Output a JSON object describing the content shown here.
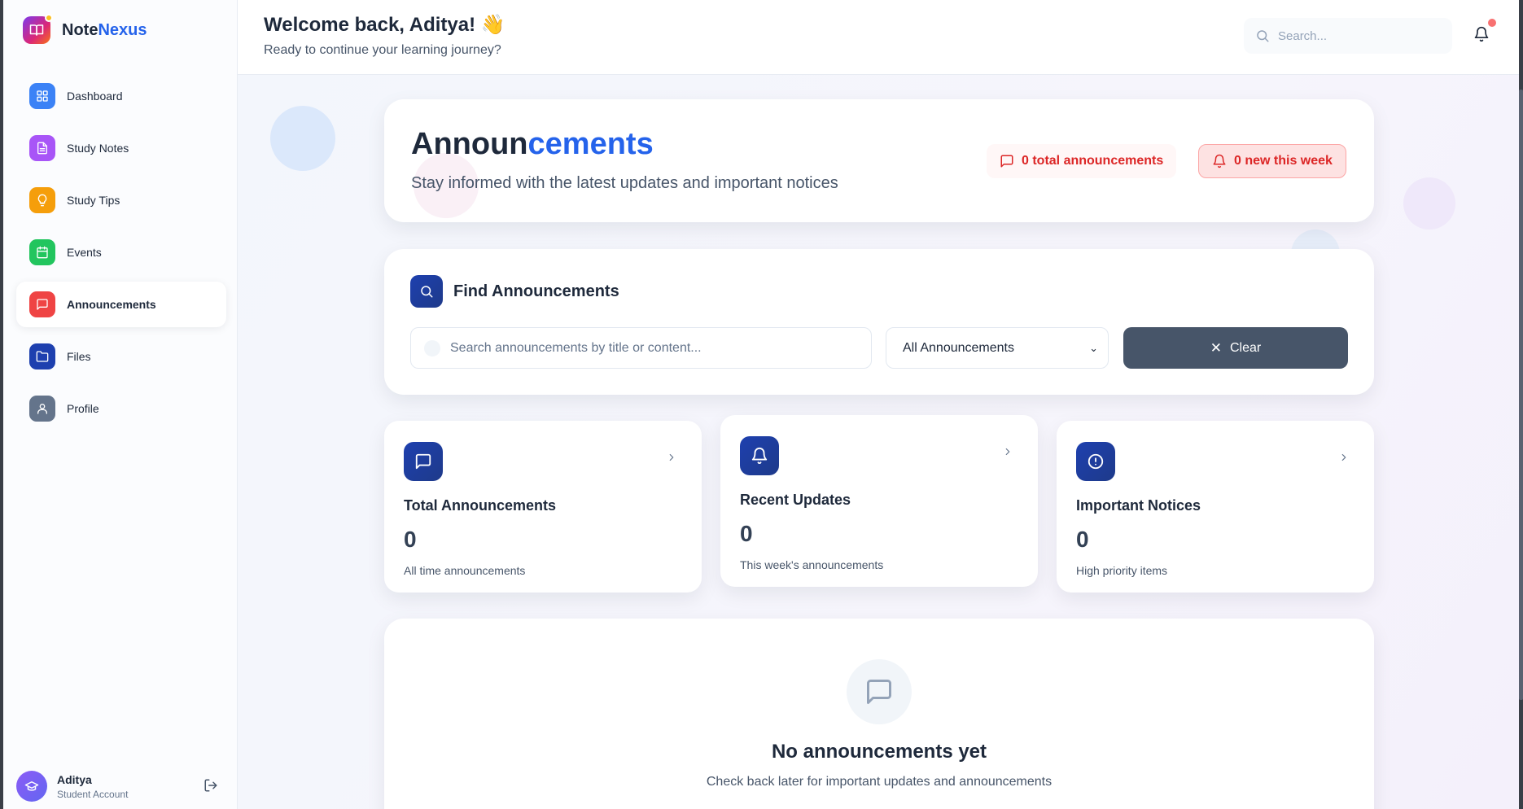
{
  "brand": {
    "name_part1": "Note",
    "name_part2": "Nexus"
  },
  "sidebar": {
    "items": [
      {
        "label": "Dashboard",
        "icon": "grid-icon",
        "color": "#3b82f6"
      },
      {
        "label": "Study Notes",
        "icon": "document-icon",
        "color": "#a855f7"
      },
      {
        "label": "Study Tips",
        "icon": "lightbulb-icon",
        "color": "#f59e0b"
      },
      {
        "label": "Events",
        "icon": "calendar-icon",
        "color": "#22c55e"
      },
      {
        "label": "Announcements",
        "icon": "message-icon",
        "color": "#ef4444",
        "active": true
      },
      {
        "label": "Files",
        "icon": "folder-icon",
        "color": "#1e40af"
      },
      {
        "label": "Profile",
        "icon": "user-icon",
        "color": "#64748b"
      }
    ]
  },
  "user": {
    "name": "Aditya",
    "role": "Student Account"
  },
  "header": {
    "welcome": "Welcome back, Aditya! 👋",
    "subtitle": "Ready to continue your learning journey?",
    "search_placeholder": "Search..."
  },
  "hero": {
    "title_part1": "Announ",
    "title_part2": "cements",
    "subtitle": "Stay informed with the latest updates and important notices",
    "total_pill": "0 total announcements",
    "new_pill": "0 new this week"
  },
  "find": {
    "title": "Find Announcements",
    "search_placeholder": "Search announcements by title or content...",
    "filter_value": "All Announcements",
    "clear_label": "Clear"
  },
  "stats": [
    {
      "title": "Total Announcements",
      "value": "0",
      "label": "All time announcements",
      "icon": "message-icon"
    },
    {
      "title": "Recent Updates",
      "value": "0",
      "label": "This week's announcements",
      "icon": "bell-icon"
    },
    {
      "title": "Important Notices",
      "value": "0",
      "label": "High priority items",
      "icon": "alert-circle-icon"
    }
  ],
  "empty": {
    "title": "No announcements yet",
    "subtitle": "Check back later for important updates and announcements"
  },
  "colors": {
    "accent": "#2563eb",
    "danger": "#dc2626",
    "dark_button": "#475569",
    "icon_navy": "#1e40af"
  }
}
